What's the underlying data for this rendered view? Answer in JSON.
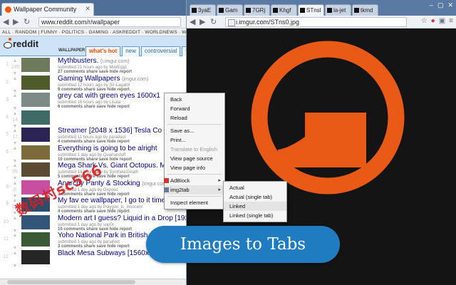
{
  "left_window": {
    "tab_title": "Wallpaper Community",
    "url": "www.reddit.com/r/wallpaper",
    "sr_bar": "ALL · RANDOM | FUNNY · POLITICS · GAMING · ASKREDDIT · WORLDNEWS · WTF · SCIENCE",
    "logo": "reddit",
    "subreddit": "WALLPAPER",
    "sort_tabs": [
      "what's hot",
      "new",
      "controversial",
      "top"
    ],
    "posts": [
      {
        "rank": "1",
        "score": "245",
        "title": "Mythbusters.",
        "domain": "(i.imgur.com)",
        "submitted": "submitted 21 hours ago by MiniEgg1",
        "actions": "27 comments share save hide report",
        "thumb": "#6e7a5c"
      },
      {
        "rank": "2",
        "score": "",
        "title": "Gaming Wallpapers",
        "domain": "(imgur.com)",
        "submitted": "submitted 12 hours ago by Sir-Lagalot",
        "actions": "9 comments share save hide report",
        "thumb": "#4e5b2a"
      },
      {
        "rank": "3",
        "score": "",
        "title": "grey cat with green eyes 1600x1",
        "domain": "",
        "submitted": "submitted 16 hours ago by Lisata",
        "actions": "6 comments share save hide report",
        "thumb": "#7d8a86"
      },
      {
        "rank": "4",
        "score": "14",
        "title": "",
        "domain": "",
        "submitted": "",
        "actions": "",
        "thumb": "#3f6a66"
      },
      {
        "rank": "5",
        "score": "17",
        "title": "Streamer [2048 x 1536] Tesla Co",
        "domain": "",
        "submitted": "submitted 11 hours ago by panafoot",
        "actions": "4 comments share save hide report",
        "thumb": "#2b2454"
      },
      {
        "rank": "6",
        "score": "",
        "title": "Everything is going to be alright",
        "domain": "",
        "submitted": "submitted 1 day ago by Quartandoff",
        "actions": "10 comments share save hide report",
        "thumb": "#7b6a3a"
      },
      {
        "rank": "7",
        "score": "99",
        "title": "Mega Shark Vs. Giant Octopus. Me",
        "domain": "",
        "submitted": "submitted 14 hours ago by SyntheticDeath",
        "actions": "5 comments share save hide report",
        "thumb": "#5b4b33"
      },
      {
        "rank": "8",
        "score": "8",
        "title": "Anarchy Panty & Stocking",
        "domain": "(imgur.com)",
        "submitted": "submitted 1 day ago by Oxpood",
        "actions": "3 comments share save hide report",
        "thumb": "#c84ea0"
      },
      {
        "rank": "9",
        "score": "55",
        "title": "My fav ee wallpaper, I go to it time and t",
        "domain": "(i.imgur.com)",
        "submitted": "submitted 1 day ago by Polygon_is_innocent",
        "actions": "4 comments share save hide report",
        "thumb": "#2f4b6b"
      },
      {
        "rank": "10",
        "score": "",
        "title": "Modern art I guess? Liquid in a Drop [1920]",
        "domain": "",
        "submitted": "submitted 1 day ago by sup0r",
        "actions": "10 comments share save hide report",
        "thumb": "#33557a"
      },
      {
        "rank": "11",
        "score": "",
        "title": "Yoho National Park in British Columbia, Can",
        "domain": "",
        "submitted": "submitted 1 day ago by panafoot",
        "actions": "3 comments share save hide report",
        "thumb": "#3a5a36"
      },
      {
        "rank": "12",
        "score": "",
        "title": "Black Mesa Subways [1560x1050]",
        "domain": "",
        "submitted": "",
        "actions": "",
        "thumb": "#262626"
      }
    ]
  },
  "right_window": {
    "tabs": [
      "3yaE",
      "Gam",
      "7GRj",
      "Khgf",
      "STnsl",
      "la-jet",
      "tkmd"
    ],
    "active_tab_index": 4,
    "url": "i.imgur.com/STns0.jpg",
    "window_controls": [
      "–",
      "▢",
      "✕"
    ],
    "logo_color": "#e85a16"
  },
  "context_menu": {
    "items": [
      {
        "label": "Back",
        "type": "item"
      },
      {
        "label": "Forward",
        "type": "item"
      },
      {
        "label": "Reload",
        "type": "item"
      },
      {
        "type": "sep"
      },
      {
        "label": "Save as...",
        "type": "item"
      },
      {
        "label": "Print...",
        "type": "item"
      },
      {
        "label": "Translate to English",
        "type": "disabled"
      },
      {
        "label": "View page source",
        "type": "item"
      },
      {
        "label": "View page info",
        "type": "item"
      },
      {
        "type": "sep"
      },
      {
        "label": "AdBlock",
        "type": "submenu",
        "icon_color": "#d8322d"
      },
      {
        "label": "img2tab",
        "type": "submenu-open",
        "icon_color": "#6b7a8f"
      },
      {
        "type": "sep"
      },
      {
        "label": "Inspect element",
        "type": "item"
      }
    ],
    "submenu": [
      "Actual",
      "Actual (single tab)",
      "Linked",
      "Linked (single tab)"
    ],
    "submenu_highlight": 2
  },
  "banner": "Images to Tabs",
  "watermark": "数码村sc566"
}
